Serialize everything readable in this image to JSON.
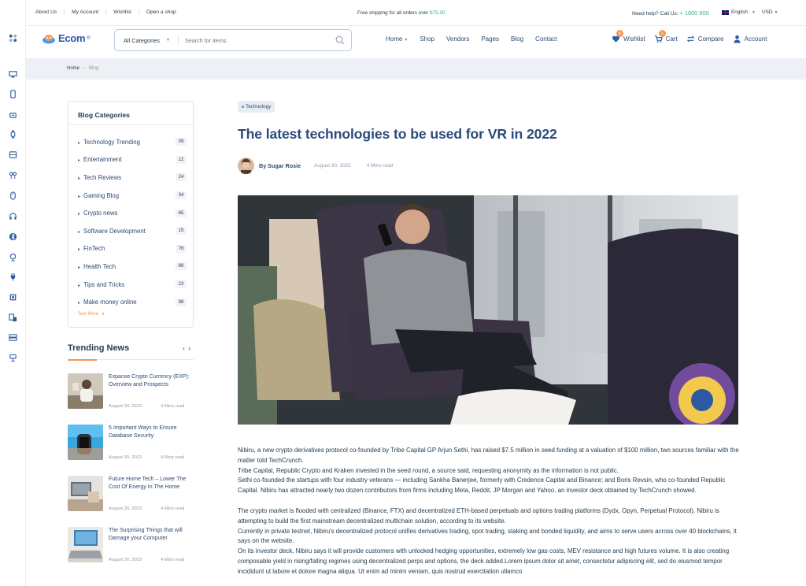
{
  "topbar": {
    "links": [
      "About Us",
      "My Account",
      "Wishlist",
      "Open a shop"
    ],
    "promo_text": "Free shipping for all orders over ",
    "promo_amount": "$75.00",
    "help_label": "Need help? Call Us: ",
    "phone": "+ 1800 900",
    "language": "English",
    "currency": "USD"
  },
  "header": {
    "logo_text": "Ecom",
    "logo_reg": "®",
    "category_select": "All Categories",
    "search_placeholder": "Search for items",
    "nav": [
      "Home",
      "Shop",
      "Vendors",
      "Pages",
      "Blog",
      "Contact"
    ],
    "wishlist": {
      "label": "Wishlist",
      "count": "6"
    },
    "cart": {
      "label": "Cart",
      "count": "2"
    },
    "compare_label": "Compare",
    "account_label": "Account"
  },
  "breadcrumb": {
    "home": "Home",
    "current": "Blog"
  },
  "sidebar": {
    "title": "Blog Categories",
    "categories": [
      {
        "label": "Technology Trending",
        "count": "09"
      },
      {
        "label": "Entertainment",
        "count": "12"
      },
      {
        "label": "Tech Reviews",
        "count": "24"
      },
      {
        "label": "Gaming Blog",
        "count": "34"
      },
      {
        "label": "Crypto news",
        "count": "65"
      },
      {
        "label": "Software Development",
        "count": "15"
      },
      {
        "label": "FinTech",
        "count": "76"
      },
      {
        "label": "Health Tech",
        "count": "89"
      },
      {
        "label": "Tips and Tricks",
        "count": "23"
      },
      {
        "label": "Make money online",
        "count": "98"
      }
    ],
    "see_more": "See More"
  },
  "trending": {
    "title": "Trending News",
    "items": [
      {
        "title": "Expanse Crypto Currency (EXP): Overview and Prospects",
        "date": "August 30, 2022",
        "read": "4 Mins read"
      },
      {
        "title": "5 Important Ways to Ensure Database Security",
        "date": "August 30, 2022",
        "read": "4 Mins read"
      },
      {
        "title": "Future Home Tech – Lower The Cost Of Energy In The Home",
        "date": "August 30, 2022",
        "read": "4 Mins read"
      },
      {
        "title": "The Surprising Things that will Damage your Computer",
        "date": "August 30, 2022",
        "read": "4 Mins read"
      }
    ]
  },
  "article": {
    "tag": "Technology",
    "title": "The latest technologies to be used for VR in 2022",
    "author": "By Sugar Rosie",
    "date": "August 30, 2022",
    "read_time": "4 Mins read",
    "paragraphs": [
      "Nibiru, a new crypto derivatives protocol co-founded by Tribe Capital GP Arjun Sethi, has raised $7.5 million in seed funding at a valuation of $100 million, two sources familiar with the matter told TechCrunch.",
      "Tribe Capital, Republic Crypto and Kraken invested in the seed round, a source said, requesting anonymity as the information is not public.",
      "Sethi co-founded the startups with four industry veterans — including Sankha Banerjee, formerly with Credence Capital and Binance; and Boris Revsin, who co-founded Republic Capital. Nibiru has attracted nearly two dozen contributors from firms including Meta, Reddit, JP Morgan and Yahoo, an investor deck obtained by TechCrunch showed.",
      "The crypto market is flooded with centralized (Binance, FTX) and decentralized ETH-based perpetuals and options trading platforms (Dydx, Opyn, Perpetual Protocol). Nibiru is attempting to build the first mainstream decentralized multichain solution, according to its website.",
      "Currently in private testnet, Nibiru's decentralized protocol unifies derivatives trading, spot trading, staking and bonded liquidity, and aims to serve users across over 40 blockchains, it says on the website.",
      "On its investor deck, Nibiru says it will provide customers with unlocked hedging opportunities, extremely low gas costs, MEV resistance and high futures volume. It is also creating composable yield in rising/falling regimes using decentralized perps and options, the deck added.Lorem ipsum dolor sit amet, consectetur adipiscing elit, sed do eiusmod tempor incididunt ut labore et dolore magna aliqua. Ut enim ad minim veniam, quis nostrud exercitation ullamco"
    ]
  },
  "colors": {
    "accent": "#3bb77e",
    "badge": "#f59758",
    "heading": "#2a4a7a",
    "breadcrumb_bg": "#eef0f5"
  },
  "rail_icons": [
    "grid-icon",
    "monitor-icon",
    "tablet-icon",
    "robot-icon",
    "watch-icon",
    "drive-icon",
    "earbuds-icon",
    "mouse-icon",
    "headphones-icon",
    "bluetooth-icon",
    "lamp-icon",
    "plug-icon",
    "cpu-icon",
    "devices-icon",
    "server-icon",
    "desk-lamp-icon"
  ]
}
